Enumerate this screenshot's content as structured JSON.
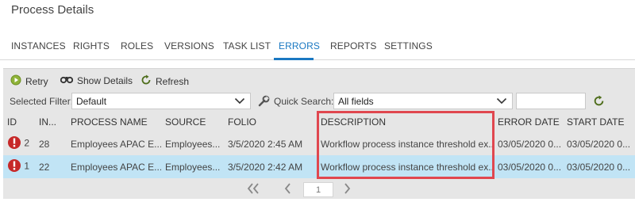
{
  "page": {
    "title": "Process Details"
  },
  "tabs": [
    {
      "label": "INSTANCES",
      "active": false
    },
    {
      "label": "RIGHTS",
      "active": false
    },
    {
      "label": "ROLES",
      "active": false
    },
    {
      "label": "VERSIONS",
      "active": false
    },
    {
      "label": "TASK LIST",
      "active": false
    },
    {
      "label": "ERRORS",
      "active": true
    },
    {
      "label": "REPORTS",
      "active": false
    },
    {
      "label": "SETTINGS",
      "active": false
    }
  ],
  "toolbar": {
    "retry_label": "Retry",
    "retry_icon": "play-circle-icon",
    "details_label": "Show Details",
    "details_icon": "binoculars-icon",
    "refresh_label": "Refresh",
    "refresh_icon": "refresh-icon"
  },
  "filters": {
    "selected_filter_label": "Selected Filter:",
    "selected_filter_value": "Default",
    "quick_search_label": "Quick Search:",
    "quick_search_value": "All fields",
    "search_text": ""
  },
  "grid": {
    "columns": [
      "ID",
      "IN...",
      "PROCESS NAME",
      "SOURCE",
      "FOLIO",
      "DESCRIPTION",
      "ERROR DATE",
      "START DATE"
    ],
    "rows": [
      {
        "id": "2",
        "instance": "28",
        "process_name": "Employees APAC E...",
        "source": "Employees...",
        "folio": "3/5/2020 2:45 AM",
        "description": "Workflow process instance threshold ex...",
        "error_date": "03/05/2020 0...",
        "start_date": "03/05/2020 0...",
        "selected": false
      },
      {
        "id": "1",
        "instance": "22",
        "process_name": "Employees APAC E...",
        "source": "Employees...",
        "folio": "3/5/2020 2:42 AM",
        "description": "Workflow process instance threshold ex...",
        "error_date": "03/05/2020 0...",
        "start_date": "03/05/2020 0...",
        "selected": true
      }
    ]
  },
  "pager": {
    "current_page": "1"
  },
  "colors": {
    "accent": "#1a78c2",
    "error": "#c62828",
    "selected_row": "#c1e4f5",
    "highlight": "#e0474f"
  }
}
